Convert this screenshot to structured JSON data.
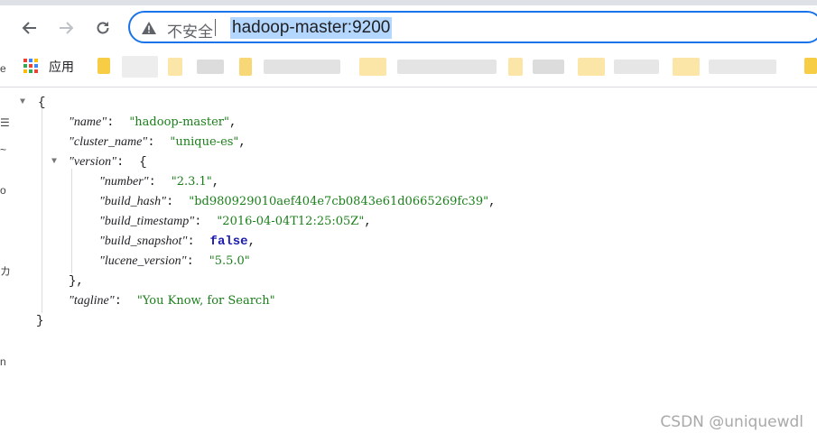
{
  "browser": {
    "nav": {
      "back_icon": "arrow-left-icon",
      "forward_icon": "arrow-right-icon",
      "reload_icon": "reload-icon"
    },
    "omnibox": {
      "security_icon": "warning-triangle-icon",
      "security_label": "不安全",
      "url": "hadoop-master:9200"
    },
    "bookmarks": {
      "apps_label": "应用"
    },
    "accent_color": "#1a73e8"
  },
  "json_view": {
    "open_brace": "{",
    "close_brace": "}",
    "name_key": "\"name\"",
    "name_value": "\"hadoop-master\"",
    "cluster_name_key": "\"cluster_name\"",
    "cluster_name_value": "\"unique-es\"",
    "version_key": "\"version\"",
    "version_open": "{",
    "version_close": "},",
    "number_key": "\"number\"",
    "number_value": "\"2.3.1\"",
    "build_hash_key": "\"build_hash\"",
    "build_hash_value": "\"bd980929010aef404e7cb0843e61d0665269fc39\"",
    "build_timestamp_key": "\"build_timestamp\"",
    "build_timestamp_value": "\"2016-04-04T12:25:05Z\"",
    "build_snapshot_key": "\"build_snapshot\"",
    "build_snapshot_value": "false",
    "lucene_version_key": "\"lucene_version\"",
    "lucene_version_value": "\"5.5.0\"",
    "tagline_key": "\"tagline\"",
    "tagline_value": "\"You Know, for Search\""
  },
  "watermark": "CSDN @uniquewdl"
}
